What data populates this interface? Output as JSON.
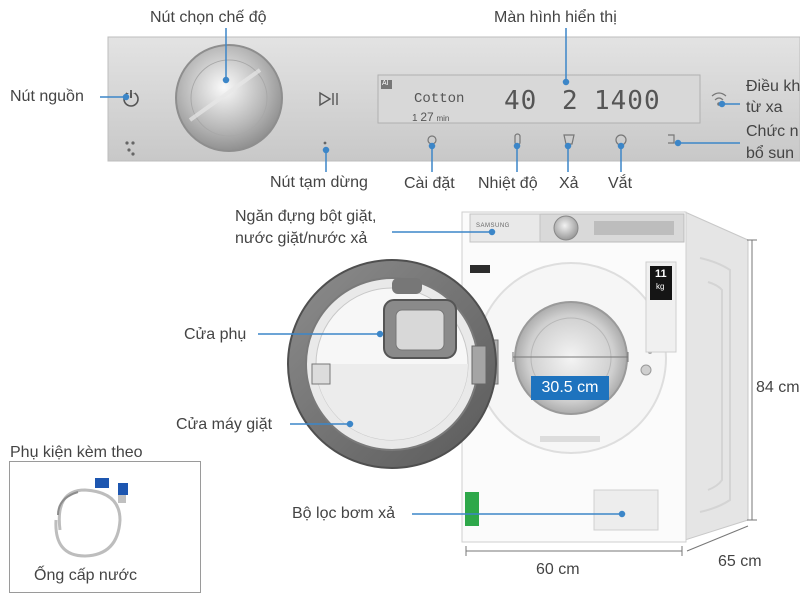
{
  "panel": {
    "program": "Cotton",
    "temp": "40",
    "rinse": "2",
    "spin": "1400",
    "time_prefix": "1",
    "time_value": "27",
    "time_suffix": "min",
    "badge": "AI",
    "brand": "SAMSUNG"
  },
  "labels": {
    "mode_knob": "Nút chọn chế độ",
    "display": "Màn hình hiển thị",
    "power": "Nút nguồn",
    "remote_1": "Điều khi",
    "remote_2": "từ xa",
    "addwash_1": "Chức n",
    "addwash_2": "bổ sun",
    "pause": "Nút tạm dừng",
    "settings": "Cài đặt",
    "temperature": "Nhiệt độ",
    "rinse": "Xả",
    "spin": "Vắt",
    "drawer_1": "Ngăn đựng bột giặt,",
    "drawer_2": "nước giặt/nước xả",
    "aux_door": "Cửa phụ",
    "main_door": "Cửa máy giặt",
    "filter": "Bộ lọc bơm xả",
    "accessory_title": "Phụ kiện kèm theo",
    "accessory_item": "Ống cấp nước"
  },
  "dimensions": {
    "door_width": "30.5 cm",
    "height": "84 cm",
    "width": "60 cm",
    "depth": "65 cm"
  },
  "sticker": {
    "number": "11",
    "unit": "kg"
  },
  "colors": {
    "leader_line": "#3c86c8",
    "dimension_box": "#1e73be",
    "panel": "#d2d2d2"
  }
}
